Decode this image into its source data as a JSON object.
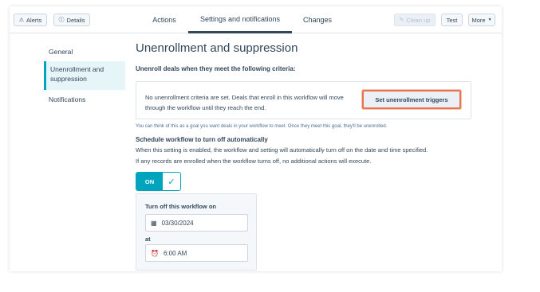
{
  "header": {
    "alerts_label": "Alerts",
    "details_label": "Details",
    "tabs": [
      "Actions",
      "Settings and notifications",
      "Changes"
    ],
    "active_tab": "Settings and notifications",
    "cleanup_label": "Clean up",
    "test_label": "Test",
    "more_label": "More"
  },
  "sidebar": {
    "items": [
      {
        "label": "General"
      },
      {
        "label": "Unenrollment and suppression"
      },
      {
        "label": "Notifications"
      }
    ]
  },
  "main": {
    "title": "Unenrollment and suppression",
    "criteria_heading": "Unenroll deals when they meet the following criteria:",
    "criteria_text": "No unenrollment criteria are set. Deals that enroll in this workflow will move through the workflow until they reach the end.",
    "triggers_button": "Set unenrollment triggers",
    "goal_hint": "You can think of this as a goal you want deals in your workflow to meet. Once they meet this goal, they'll be unenrolled.",
    "schedule_heading": "Schedule workflow to turn off automatically",
    "schedule_desc_1": "When this setting is enabled, the workflow and setting will automatically turn off on the date and time specified.",
    "schedule_desc_2": "If any records are enrolled when the workflow turns off, no additional actions will execute.",
    "toggle_label": "ON",
    "turn_off_label": "Turn off this workflow on",
    "date_value": "03/30/2024",
    "at_label": "at",
    "time_value": "6:00 AM"
  },
  "colors": {
    "accent": "#00a4bd",
    "highlight_border": "#e8744f",
    "text": "#33475b"
  },
  "icons": {
    "alerts": "warning-icon",
    "details": "info-icon",
    "more": "caret-down-icon",
    "toggle": "checkmark-icon",
    "date": "calendar-icon",
    "time": "alarm-clock-icon"
  }
}
